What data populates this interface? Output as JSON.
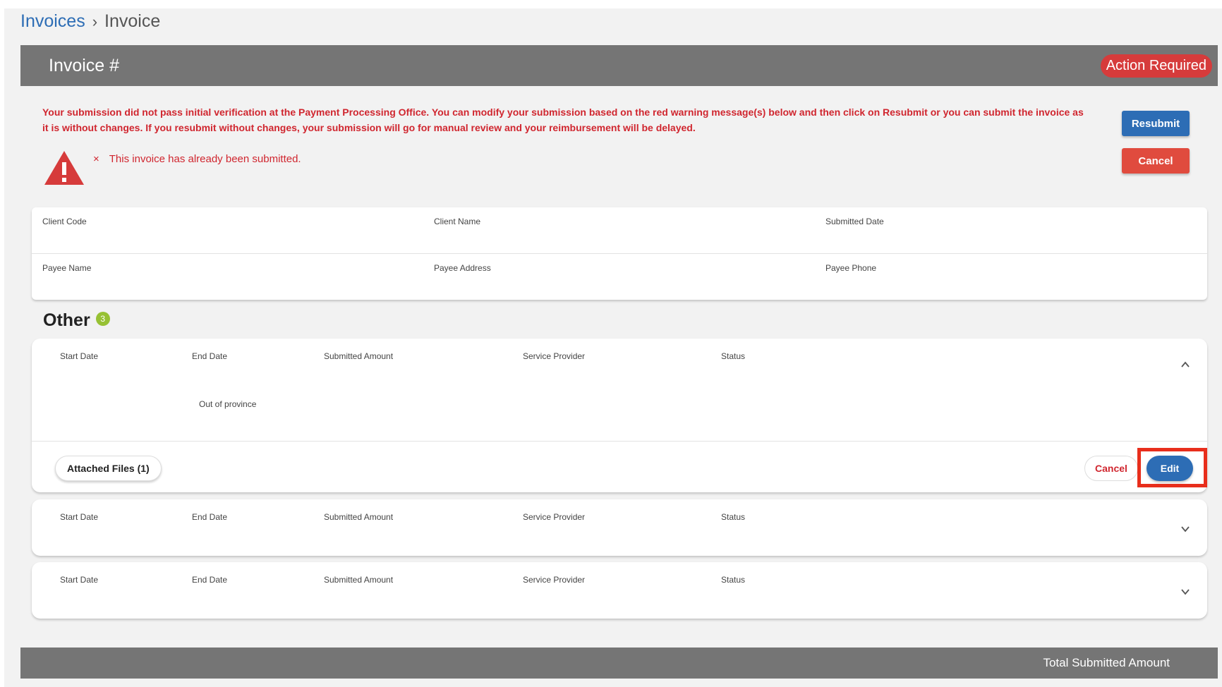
{
  "breadcrumb": {
    "parent": "Invoices",
    "separator": "›",
    "current": "Invoice"
  },
  "header": {
    "title": "Invoice #",
    "status": "Action Required",
    "status_color": "#d63b3b",
    "bar_color": "#757575"
  },
  "alert": {
    "message": "Your submission did not pass initial verification at the Payment Processing Office. You can modify your submission based on the red warning message(s) below and then click on Resubmit or you can submit the invoice as it is without changes. If you resubmit without changes, your submission will go for manual review and your reimbursement will be delayed.",
    "error_mark": "×",
    "error": "This invoice has already been submitted.",
    "icon": "warning-triangle-icon",
    "color": "#d0262f"
  },
  "actions": {
    "resubmit": "Resubmit",
    "cancel": "Cancel"
  },
  "details": {
    "client_code_label": "Client Code",
    "client_name_label": "Client Name",
    "submitted_date_label": "Submitted Date",
    "payee_name_label": "Payee Name",
    "payee_address_label": "Payee Address",
    "payee_phone_label": "Payee Phone"
  },
  "section": {
    "title": "Other",
    "count": "3"
  },
  "columns": {
    "start_date": "Start Date",
    "end_date": "End Date",
    "submitted_amount": "Submitted Amount",
    "service_provider": "Service Provider",
    "status": "Status"
  },
  "line_items": [
    {
      "expanded": true,
      "category": "Out of province",
      "attached_files": "Attached Files (1)",
      "cancel": "Cancel",
      "edit": "Edit"
    },
    {
      "expanded": false
    },
    {
      "expanded": false
    }
  ],
  "footer": {
    "total_label": "Total Submitted Amount"
  },
  "colors": {
    "primary": "#2d6db5",
    "danger": "#e04b3e",
    "badge": "#97c134",
    "highlight": "#e82e1c"
  }
}
